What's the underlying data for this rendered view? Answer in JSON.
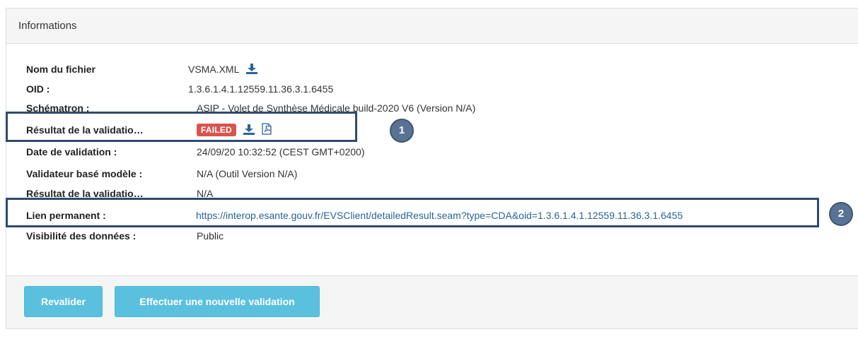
{
  "panel": {
    "title": "Informations"
  },
  "fields": [
    {
      "label": "Nom du fichier",
      "value": "VSMA.XML"
    },
    {
      "label": "OID :",
      "value": "1.3.6.1.4.1.12559.11.36.3.1.6455"
    },
    {
      "label": "Schématron :",
      "value": "ASIP - Volet de Synthèse Médicale build-2020 V6 (Version N/A)"
    },
    {
      "label": "Résultat de la validatio…",
      "value": "FAILED"
    },
    {
      "label": "Date de validation :",
      "value": "24/09/20 10:32:52 (CEST GMT+0200)"
    },
    {
      "label": "Validateur basé modèle :",
      "value": "N/A (Outil Version N/A)"
    },
    {
      "label": "Résultat de la validatio…",
      "value": "N/A"
    },
    {
      "label": "Lien permanent :",
      "value": "https://interop.esante.gouv.fr/EVSClient/detailedResult.seam?type=CDA&oid=1.3.6.1.4.1.12559.11.36.3.1.6455"
    },
    {
      "label": "Visibilité des données :",
      "value": "Public"
    }
  ],
  "callouts": {
    "one": "1",
    "two": "2"
  },
  "footer": {
    "revalidate_label": "Revalider",
    "new_validation_label": "Effectuer une nouvelle validation"
  },
  "icons": {
    "download": "download-icon",
    "pdf": "pdf-icon"
  },
  "colors": {
    "failed_badge": "#d9534f",
    "link": "#2a6496",
    "button": "#5bc0de",
    "callout_border": "#2f4a6f",
    "callout_circle": "#5a7294"
  }
}
